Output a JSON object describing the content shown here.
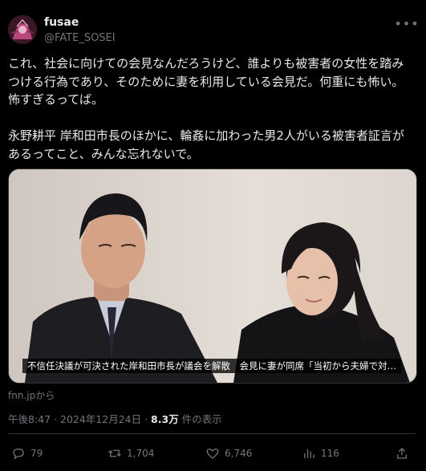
{
  "tweet": {
    "display_name": "fusae",
    "handle": "@FATE_SOSEI",
    "more_icon": "more-horizontal-icon",
    "body": "これ、社会に向けての会見なんだろうけど、誰よりも被害者の女性を踏み\nつける行為であり、そのために妻を利用している会見だ。何重にも怖い。\n怖すぎるってば。\n\n永野耕平 岸和田市長のほかに、輪姦に加わった男2人がいる被害者証言が\nあるってこと、みんな忘れないで。",
    "media": {
      "caption": "不信任決議が可決された岸和田市長が議会を解散　会見に妻が同席「当初から夫婦で対…",
      "source": "fnn.jpから"
    },
    "meta": {
      "time": "午後8:47 · 2024年12月24日 · ",
      "views_count": "8.3万",
      "views_label": " 件の表示"
    },
    "actions": {
      "reply_count": "79",
      "retweet_count": "1,704",
      "like_count": "6,746",
      "bookmark_count": "116"
    }
  },
  "colors": {
    "background": "#000000",
    "text": "#e7e9ea",
    "muted": "#71767b",
    "border": "#2f3336"
  }
}
